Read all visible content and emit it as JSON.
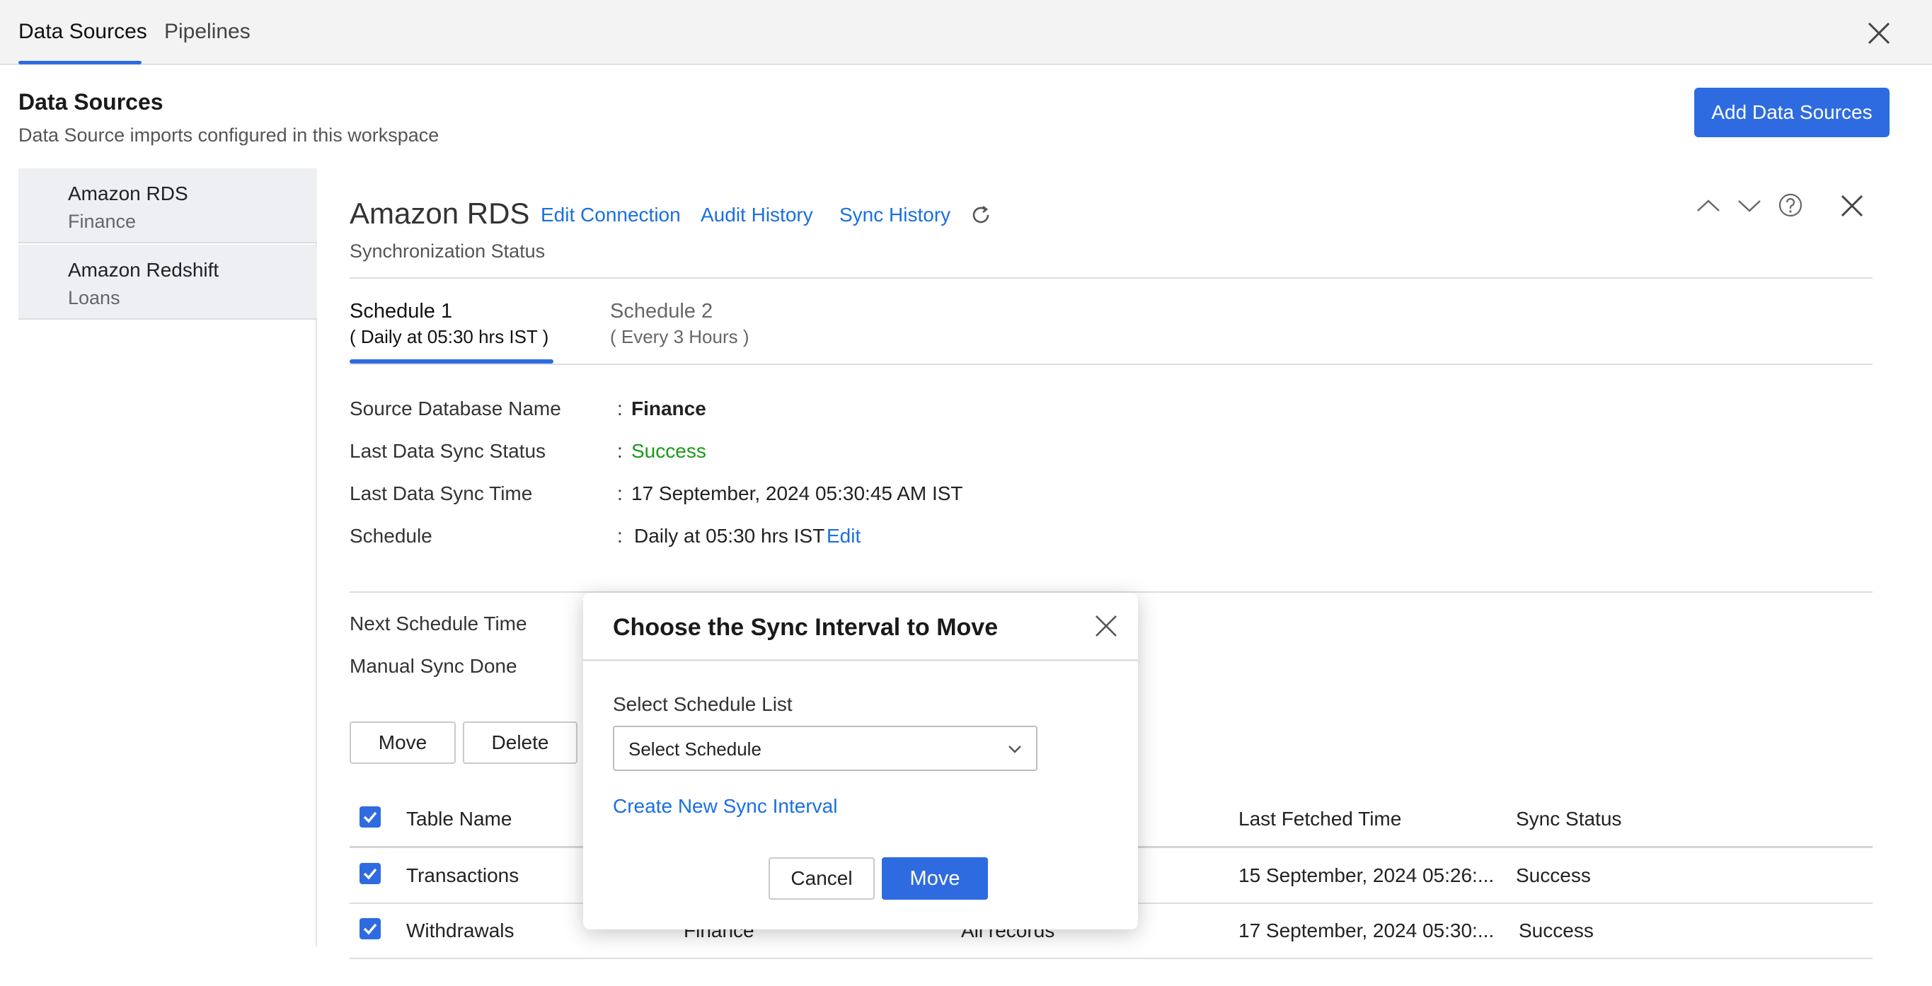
{
  "top_tabs": [
    {
      "label": "Data Sources",
      "active": true
    },
    {
      "label": "Pipelines",
      "active": false
    }
  ],
  "header": {
    "title": "Data Sources",
    "subtitle": "Data Source imports configured in this workspace",
    "add_button": "Add Data Sources"
  },
  "sidebar": {
    "items": [
      {
        "name": "Amazon RDS",
        "sub": "Finance"
      },
      {
        "name": "Amazon Redshift",
        "sub": "Loans"
      }
    ]
  },
  "detail": {
    "title": "Amazon RDS",
    "links": {
      "edit_connection": "Edit Connection",
      "audit_history": "Audit History",
      "sync_history": "Sync History"
    },
    "subtitle": "Synchronization Status",
    "schedule_tabs": [
      {
        "name": "Schedule 1",
        "desc": "( Daily at 05:30 hrs IST )"
      },
      {
        "name": "Schedule 2",
        "desc": "( Every 3 Hours )"
      }
    ],
    "info": {
      "source_db_label": "Source Database Name",
      "source_db_value": "Finance",
      "last_status_label": "Last Data Sync Status",
      "last_status_value": "Success",
      "last_time_label": "Last Data Sync Time",
      "last_time_value": "17 September, 2024 05:30:45 AM IST",
      "schedule_label": "Schedule",
      "schedule_value": "Daily at 05:30 hrs IST",
      "schedule_edit": "Edit",
      "next_time_label": "Next Schedule Time",
      "manual_sync_label": "Manual Sync Done",
      "colon": ":"
    },
    "buttons": {
      "move": "Move",
      "delete": "Delete"
    },
    "table": {
      "headers": {
        "table_name": "Table Name",
        "last_fetched": "Last Fetched Time",
        "sync_status": "Sync Status"
      },
      "rows": [
        {
          "name": "Transactions",
          "database": "",
          "records": "",
          "last_fetched": "15 September, 2024 05:26:...",
          "status": "Success"
        },
        {
          "name": "Withdrawals",
          "database": "Finance",
          "records": "All records",
          "last_fetched": "17 September, 2024 05:30:...",
          "status": "Success"
        }
      ]
    }
  },
  "modal": {
    "title": "Choose the Sync Interval to Move",
    "select_label": "Select Schedule List",
    "select_value": "Select Schedule",
    "create_link": "Create New Sync Interval",
    "cancel": "Cancel",
    "move": "Move"
  },
  "colors": {
    "accent": "#2f6be0",
    "link": "#1b6fe0",
    "success": "#1a9a1a"
  }
}
